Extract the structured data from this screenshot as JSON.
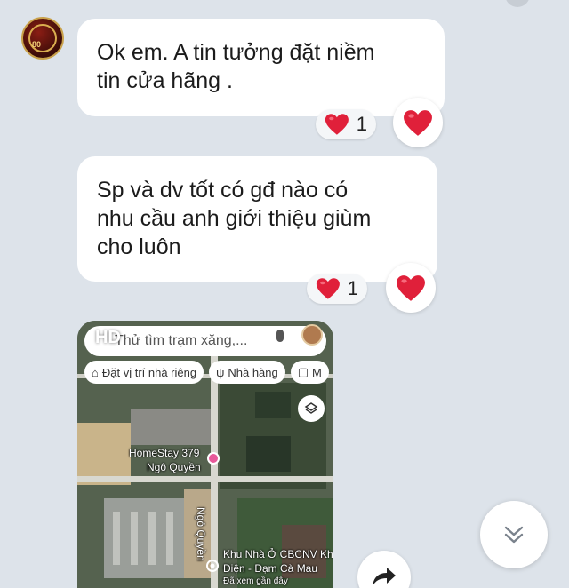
{
  "messages": [
    {
      "lines": [
        "Ok em. A tin tưởng đặt niềm",
        "tin cửa hãng ."
      ],
      "reaction": {
        "icon": "heart-icon",
        "count": "1"
      }
    },
    {
      "lines": [
        "Sp và dv tốt có gđ nào có",
        "nhu cầu anh giới thiệu giùm",
        "cho luôn"
      ],
      "reaction": {
        "icon": "heart-icon",
        "count": "1"
      }
    }
  ],
  "avatar": {
    "badge": "80"
  },
  "map_card": {
    "hd_label": "HD",
    "search_placeholder": "Thử tìm trạm xăng,...",
    "chips": [
      {
        "icon": "home-icon",
        "label": "Đặt vị trí nhà riêng"
      },
      {
        "icon": "restaurant-icon",
        "label": "Nhà hàng"
      },
      {
        "icon": "bag-icon",
        "label": "M"
      }
    ],
    "place_labels": {
      "homestay_line1": "HomeStay 379",
      "homestay_line2": "Ngô Quyền",
      "street": "Ngô Quyền",
      "poi_line1": "Khu Nhà Ở CBCNV Khí",
      "poi_line2": "Điện - Đạm Cà Mau",
      "poi_line3": "Đã xem gần đây"
    }
  },
  "colors": {
    "background": "#dde3ea",
    "bubble": "#ffffff",
    "heart": "#e0203a"
  }
}
